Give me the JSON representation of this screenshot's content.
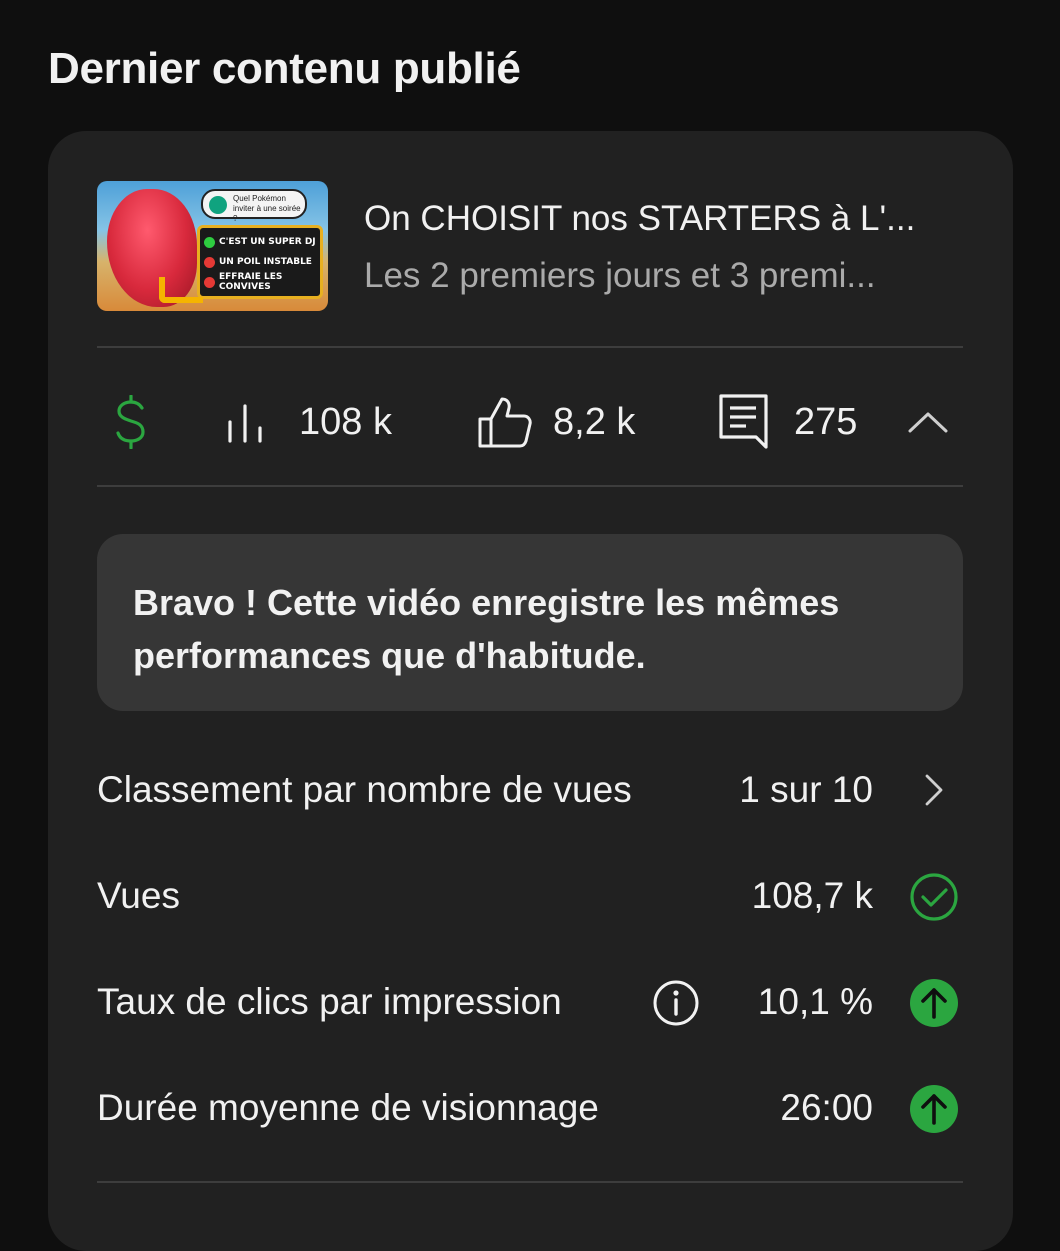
{
  "section": {
    "title": "Dernier contenu publié"
  },
  "video": {
    "title": "On CHOISIT nos STARTERS à L'...",
    "subtitle": "Les 2 premiers jours et 3 premi...",
    "thumbnail": {
      "bubble_text": "Quel Pokémon inviter à une soirée ?",
      "options": [
        {
          "text": "C'EST UN SUPER DJ",
          "status": "check"
        },
        {
          "text": "UN POIL INSTABLE",
          "status": "cross"
        },
        {
          "text": "EFFRAIE LES CONVIVES",
          "status": "cross"
        }
      ]
    }
  },
  "stats": {
    "revenue_icon": "dollar-icon",
    "views": {
      "icon": "bar-chart-icon",
      "value": "108 k"
    },
    "likes": {
      "icon": "thumbs-up-icon",
      "value": "8,2 k"
    },
    "comments": {
      "icon": "comment-icon",
      "value": "275"
    },
    "collapse_icon": "chevron-up-icon"
  },
  "banner": {
    "text": "Bravo ! Cette vidéo enregistre les mêmes performances que d'habitude."
  },
  "metrics": [
    {
      "label": "Classement par nombre de vues",
      "value": "1 sur 10",
      "icon": "chevron-right-icon"
    },
    {
      "label": "Vues",
      "value": "108,7 k",
      "icon": "check-circle-icon"
    },
    {
      "label": "Taux de clics par impression",
      "value": "10,1 %",
      "icon": "arrow-up-circle-icon",
      "info_icon": "info-icon"
    },
    {
      "label": "Durée moyenne de visionnage",
      "value": "26:00",
      "icon": "arrow-up-circle-icon"
    }
  ],
  "colors": {
    "background": "#0f0f0f",
    "card": "#212121",
    "banner": "#363636",
    "positive": "#2ba640",
    "revenue": "#2ba640",
    "secondary_text": "#aaaaaa"
  }
}
